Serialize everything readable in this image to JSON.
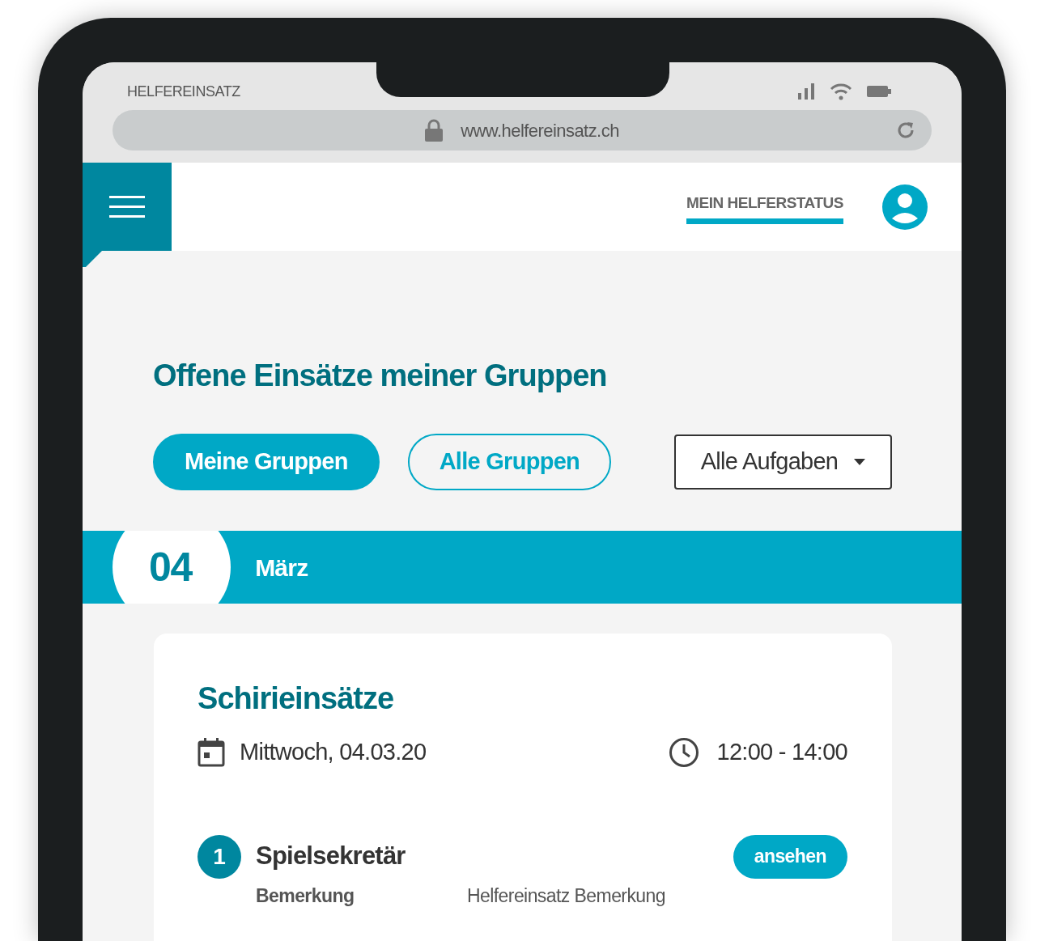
{
  "browser": {
    "title": "HELFEREINSATZ",
    "url": "www.helfereinsatz.ch"
  },
  "header": {
    "status_link": "MEIN HELFERSTATUS"
  },
  "heading": "Offene Einsätze meiner Gruppen",
  "filters": [
    {
      "label": "Meine Gruppen",
      "selected": true
    },
    {
      "label": "Alle Gruppen",
      "selected": false
    }
  ],
  "task_dropdown": {
    "value": "Alle Aufgaben"
  },
  "date_band": {
    "day": "04",
    "month": "März"
  },
  "event": {
    "title": "Schirieinsätze",
    "date": "Mittwoch, 04.03.20",
    "time": "12:00 - 14:00",
    "tasks": [
      {
        "number": "1",
        "name": "Spielsekretär",
        "action": "ansehen",
        "details": [
          {
            "label": "Bemerkung",
            "value": "Helfereinsatz Bemerkung"
          }
        ]
      }
    ]
  }
}
